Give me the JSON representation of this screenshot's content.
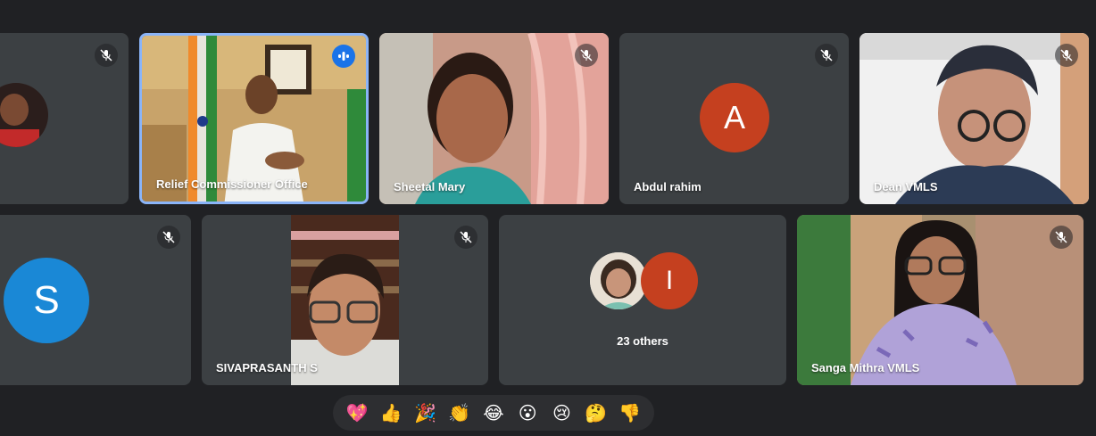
{
  "participants": [
    {
      "name": "",
      "muted": true
    },
    {
      "name": "Relief Commissioner Office",
      "speaking": true
    },
    {
      "name": "Sheetal Mary",
      "muted": true
    },
    {
      "name": "Abdul rahim",
      "initial": "A",
      "avatar_color": "#c5401f",
      "muted": true
    },
    {
      "name": "Dean VMLS",
      "muted": true
    },
    {
      "name": "",
      "initial": "S",
      "avatar_color": "#1a88d6",
      "muted": true
    },
    {
      "name": "SIVAPRASANTH S",
      "muted": true
    },
    {
      "name": "Sanga Mithra VMLS",
      "muted": true
    }
  ],
  "others": {
    "label": "23 others",
    "initial": "I",
    "avatar_color": "#c5401f"
  },
  "reactions": [
    "💖",
    "👍",
    "🎉",
    "👏",
    "😂",
    "😮",
    "😢",
    "🤔",
    "👎"
  ],
  "colors": {
    "background": "#202124",
    "tile": "#3c4043",
    "active_border": "#8ab4f8"
  }
}
